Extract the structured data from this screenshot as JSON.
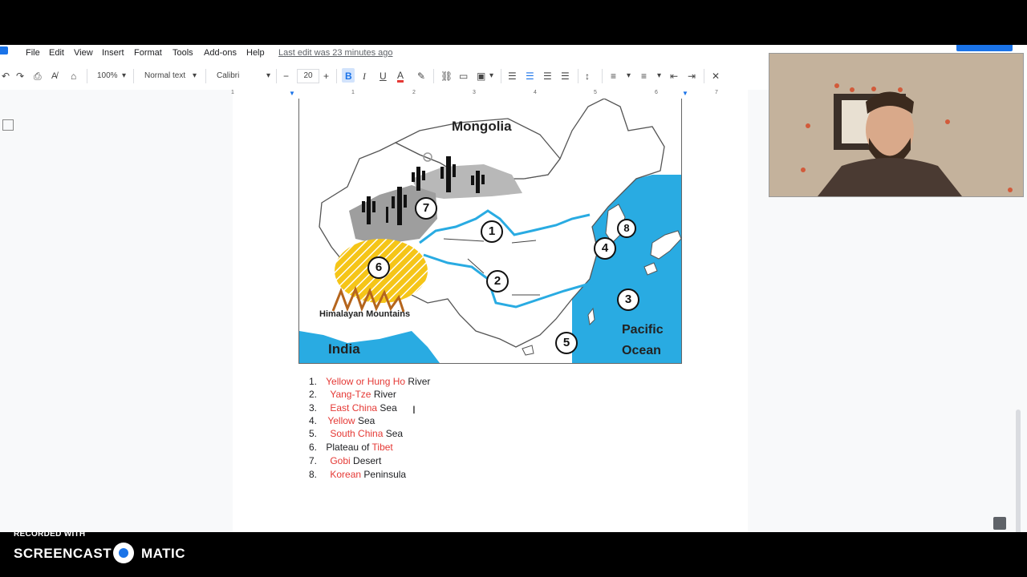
{
  "menu": {
    "items": [
      "File",
      "Edit",
      "View",
      "Insert",
      "Format",
      "Tools",
      "Add-ons",
      "Help"
    ],
    "last_edit": "Last edit was 23 minutes ago"
  },
  "toolbar": {
    "zoom": "100%",
    "style": "Normal text",
    "font": "Calibri",
    "font_size": "20",
    "bold": "B",
    "italic": "I",
    "underline": "U",
    "text_color": "A"
  },
  "ruler": [
    "1",
    "1",
    "2",
    "3",
    "4",
    "5",
    "6",
    "7"
  ],
  "map": {
    "labels": {
      "mongolia": "Mongolia",
      "himalaya": "Himalayan Mountains",
      "india": "India",
      "pacific1": "Pacific",
      "pacific2": "Ocean"
    },
    "numbers": [
      "1",
      "2",
      "3",
      "4",
      "5",
      "6",
      "7",
      "8"
    ],
    "colors": {
      "water": "#29abe2",
      "plateau": "#f5c518",
      "desert": "#9e9e9e",
      "mountains": "#b5651d"
    }
  },
  "list": [
    {
      "num": "1.",
      "red": "Yellow or Hung Ho",
      "black": "River"
    },
    {
      "num": "2.",
      "red": "Yang-Tze",
      "black": "River"
    },
    {
      "num": "3.",
      "red": "East China",
      "black": "Sea"
    },
    {
      "num": "4.",
      "red": "Yellow",
      "black": "Sea"
    },
    {
      "num": "5.",
      "red": "South China",
      "black": "Sea"
    },
    {
      "num": "6.",
      "black_pre": "Plateau of",
      "red": "Tibet"
    },
    {
      "num": "7.",
      "red": "Gobi",
      "black": "Desert"
    },
    {
      "num": "8.",
      "red": "Korean",
      "black": "Peninsula"
    }
  ],
  "recording": {
    "small": "RECORDED WITH",
    "brand1": "SCREENCAST",
    "brand2": "MATIC"
  }
}
